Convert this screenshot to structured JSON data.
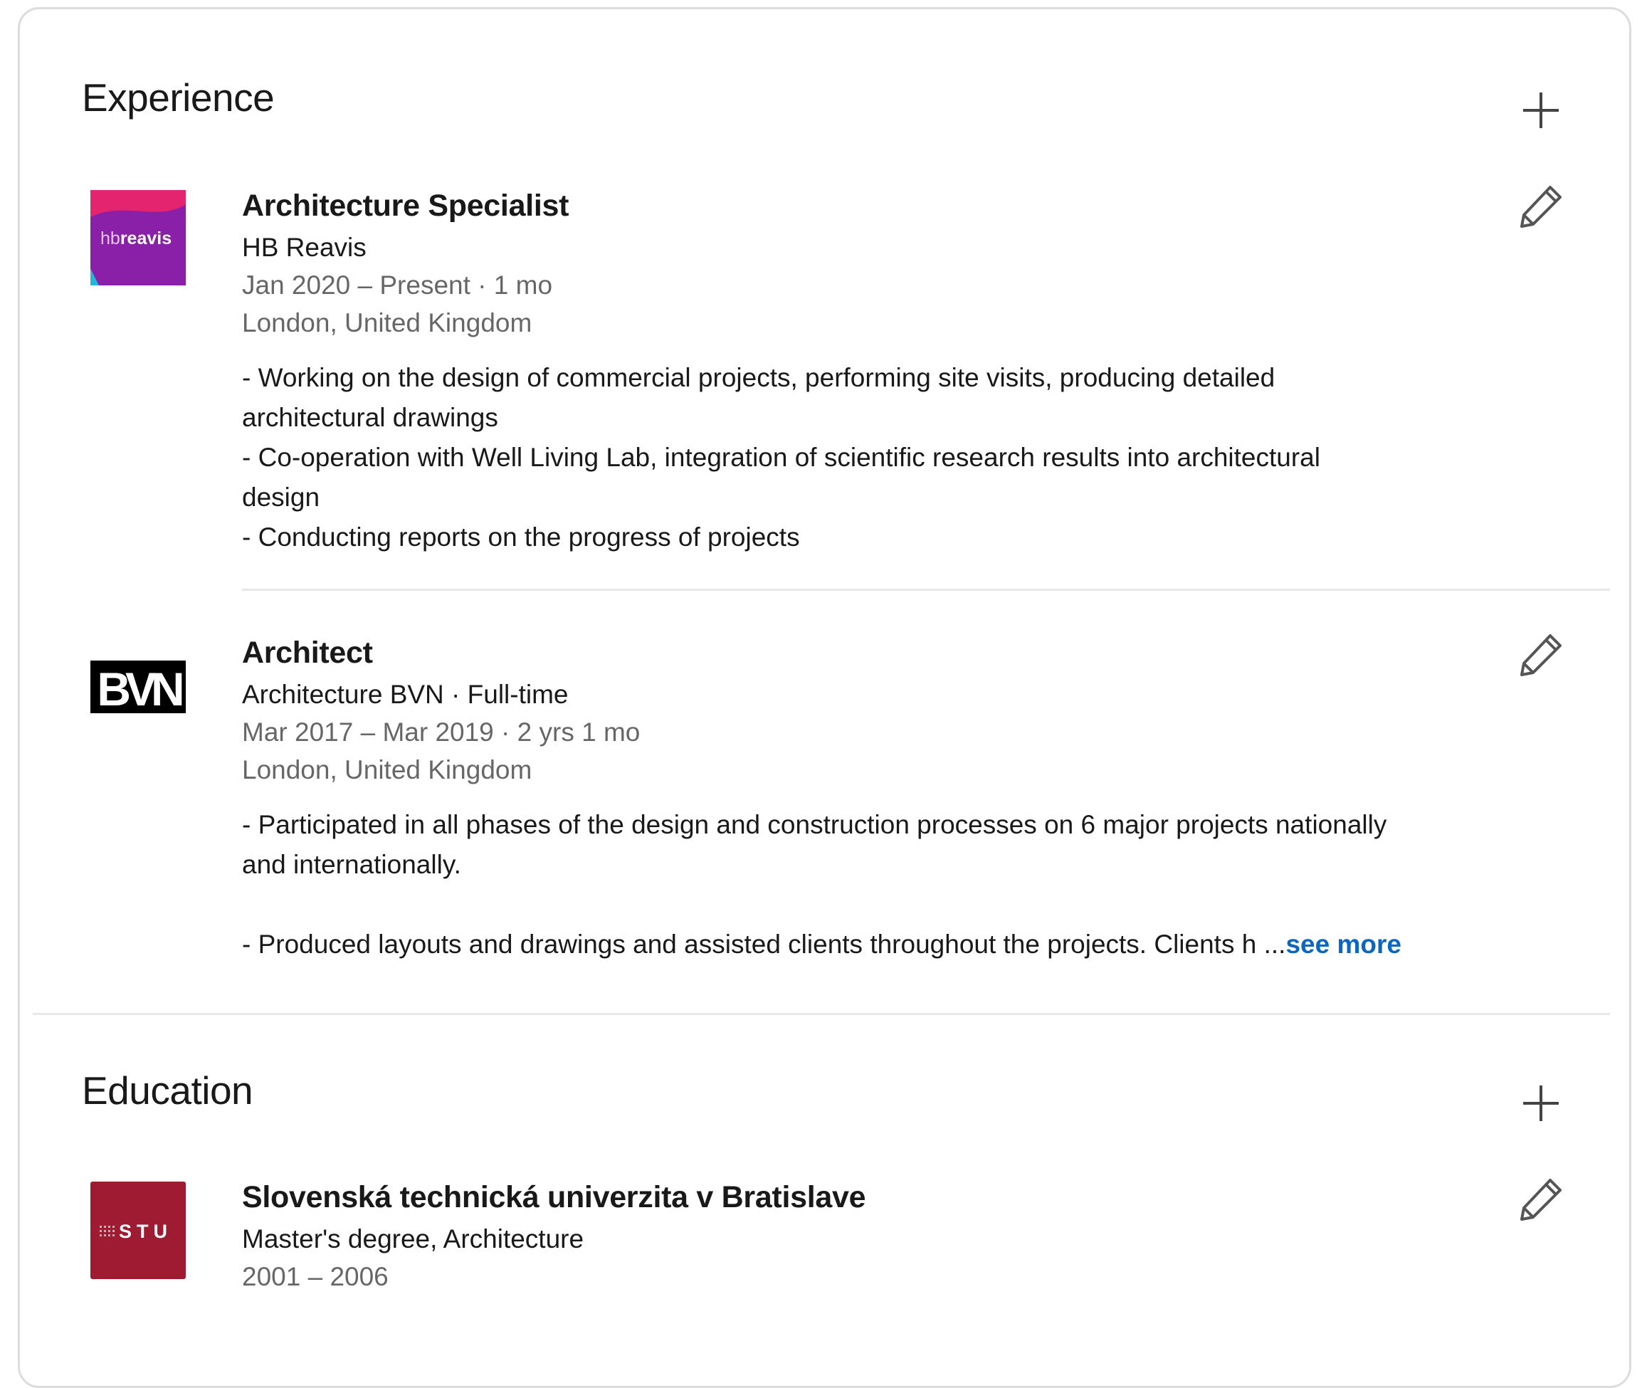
{
  "experience": {
    "title": "Experience",
    "add_label": "Add experience",
    "items": [
      {
        "logo_text_light": "hb",
        "logo_text_bold": "reavis",
        "title": "Architecture Specialist",
        "company": "HB Reavis",
        "dates": "Jan 2020 – Present · 1 mo",
        "location": "London, United Kingdom",
        "description": [
          "- Working on the design of commercial projects, performing site visits, producing detailed",
          "architectural drawings",
          "- Co-operation with Well Living Lab, integration of scientific research results into architectural",
          "design",
          "- Conducting reports on the progress of projects"
        ]
      },
      {
        "logo_text": "BVN",
        "title": "Architect",
        "company": "Architecture BVN · Full-time",
        "dates": "Mar 2017 – Mar 2019 · 2 yrs 1 mo",
        "location": "London, United Kingdom",
        "description": [
          "- Participated in all phases of the design and construction processes on 6 major projects nationally",
          "and internationally."
        ],
        "description_truncated": "- Produced layouts and drawings and assisted clients throughout the projects. Clients h ...",
        "see_more": "see more"
      }
    ]
  },
  "education": {
    "title": "Education",
    "add_label": "Add education",
    "items": [
      {
        "logo_text": "STU",
        "school": "Slovenská technická univerzita v Bratislave",
        "degree": "Master's degree, Architecture",
        "dates": "2001 – 2006"
      }
    ]
  },
  "colors": {
    "link": "#0a66c2",
    "hb_logo_purple": "#8a1fa8",
    "hb_logo_pink": "#e5246f",
    "stu_logo_red": "#9e1b32"
  }
}
